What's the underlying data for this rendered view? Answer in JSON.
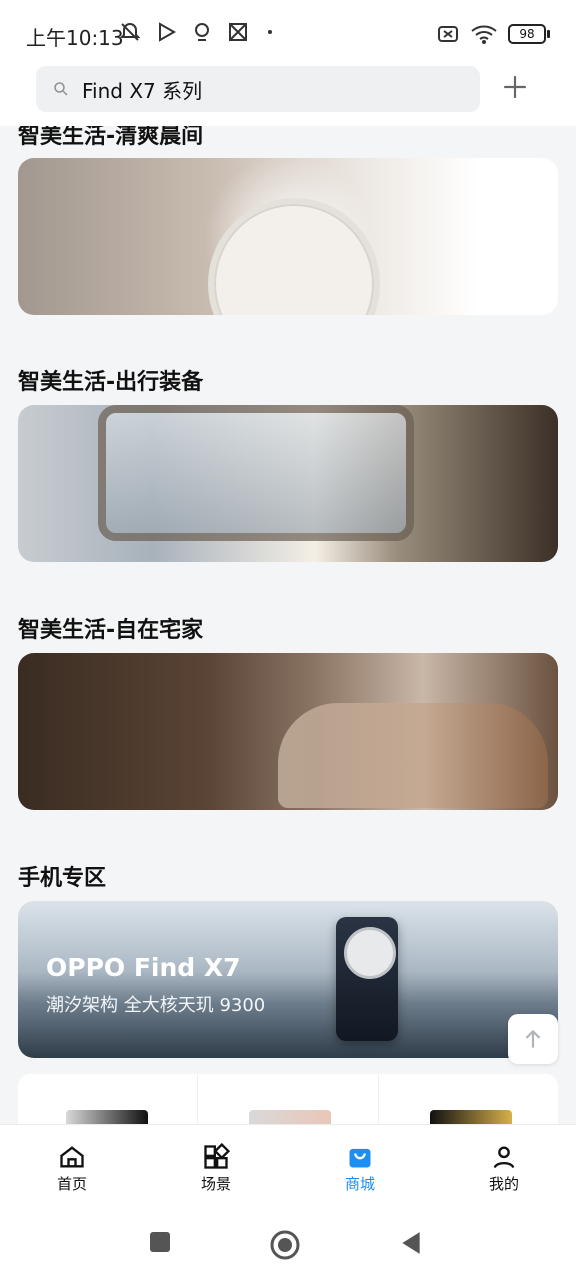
{
  "status_bar": {
    "time": "上午10:13",
    "battery": "98"
  },
  "search": {
    "text": "Find X7 系列"
  },
  "sections": [
    {
      "title": "智美生活-清爽晨间"
    },
    {
      "title": "智美生活-出行装备"
    },
    {
      "title": "智美生活-自在宅家"
    },
    {
      "title": "手机专区"
    }
  ],
  "phone_banner": {
    "title": "OPPO Find X7",
    "subtitle": "潮汐架构 全大核天玑 9300"
  },
  "bottom_nav": {
    "items": [
      {
        "label": "首页"
      },
      {
        "label": "场景"
      },
      {
        "label": "商城"
      },
      {
        "label": "我的"
      }
    ],
    "active": "商城",
    "active_color": "#1f8ef1"
  }
}
